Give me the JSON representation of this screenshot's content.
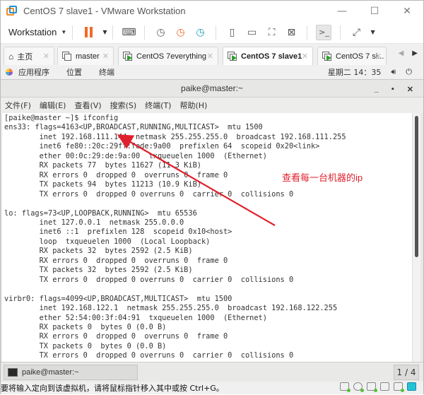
{
  "window": {
    "title": "CentOS 7  slave1 - VMware Workstation",
    "controls": {
      "minimize": "—",
      "maximize": "☐",
      "close": "✕"
    }
  },
  "toolbar": {
    "workstation_label": "Workstation",
    "icons": [
      "pause-icon",
      "send-keys-icon",
      "snapshot-icon",
      "revert-snapshot-icon",
      "snapshot-manager-icon",
      "sidebar-view-icon",
      "thumbnail-view-icon",
      "fullscreen-icon",
      "unity-icon",
      "console-view-icon",
      "stretch-icon"
    ]
  },
  "tabs": [
    {
      "label": "主页",
      "icon": "home-icon",
      "active": false
    },
    {
      "label": "master",
      "icon": "vm-icon",
      "active": false
    },
    {
      "label": "CentOS 7everything",
      "icon": "vm-running-icon",
      "active": false
    },
    {
      "label": "CentOS 7  slave1",
      "icon": "vm-running-icon",
      "active": true
    },
    {
      "label": "CentOS 7 sl...",
      "icon": "vm-running-icon",
      "active": false
    }
  ],
  "gnome_panel": {
    "applications": "应用程序",
    "places": "位置",
    "terminal": "终端",
    "clock": "星期二 14：35"
  },
  "terminal": {
    "title": "paike@master:~",
    "menu": [
      "文件(F)",
      "编辑(E)",
      "查看(V)",
      "搜索(S)",
      "终端(T)",
      "帮助(H)"
    ],
    "lines": [
      "[paike@master ~]$ ifconfig",
      "ens33: flags=4163<UP,BROADCAST,RUNNING,MULTICAST>  mtu 1500",
      "        inet 192.168.111.144  netmask 255.255.255.0  broadcast 192.168.111.255",
      "        inet6 fe80::20c:29ff:fede:9a00  prefixlen 64  scopeid 0x20<link>",
      "        ether 00:0c:29:de:9a:00  txqueuelen 1000  (Ethernet)",
      "        RX packets 77  bytes 11627 (11.3 KiB)",
      "        RX errors 0  dropped 0  overruns 0  frame 0",
      "        TX packets 94  bytes 11213 (10.9 KiB)",
      "        TX errors 0  dropped 0 overruns 0  carrier 0  collisions 0",
      "",
      "lo: flags=73<UP,LOOPBACK,RUNNING>  mtu 65536",
      "        inet 127.0.0.1  netmask 255.0.0.0",
      "        inet6 ::1  prefixlen 128  scopeid 0x10<host>",
      "        loop  txqueuelen 1000  (Local Loopback)",
      "        RX packets 32  bytes 2592 (2.5 KiB)",
      "        RX errors 0  dropped 0  overruns 0  frame 0",
      "        TX packets 32  bytes 2592 (2.5 KiB)",
      "        TX errors 0  dropped 0 overruns 0  carrier 0  collisions 0",
      "",
      "virbr0: flags=4099<UP,BROADCAST,MULTICAST>  mtu 1500",
      "        inet 192.168.122.1  netmask 255.255.255.0  broadcast 192.168.122.255",
      "        ether 52:54:00:3f:04:91  txqueuelen 1000  (Ethernet)",
      "        RX packets 0  bytes 0 (0.0 B)",
      "        RX errors 0  dropped 0  overruns 0  frame 0",
      "        TX packets 0  bytes 0 (0.0 B)",
      "        TX errors 0  dropped 0 overruns 0  carrier 0  collisions 0"
    ]
  },
  "annotation": {
    "text": "查看每一台机器的ip",
    "color": "#e0202c"
  },
  "taskbar": {
    "item_label": "paike@master:~",
    "pager": "1 / 4"
  },
  "statusbar": {
    "message": "要将输入定向到该虚拟机，请将鼠标指针移入其中或按 Ctrl+G。",
    "icons": [
      "hard-disk-icon",
      "cd-dvd-icon",
      "network-adapter-icon",
      "printer-icon",
      "sound-card-icon",
      "vm-display-icon"
    ]
  },
  "colors": {
    "pause_orange": "#f06a28",
    "running_green": "#2aa02a",
    "logo_orange": "#f28b20",
    "logo_blue": "#1f8fd6"
  }
}
